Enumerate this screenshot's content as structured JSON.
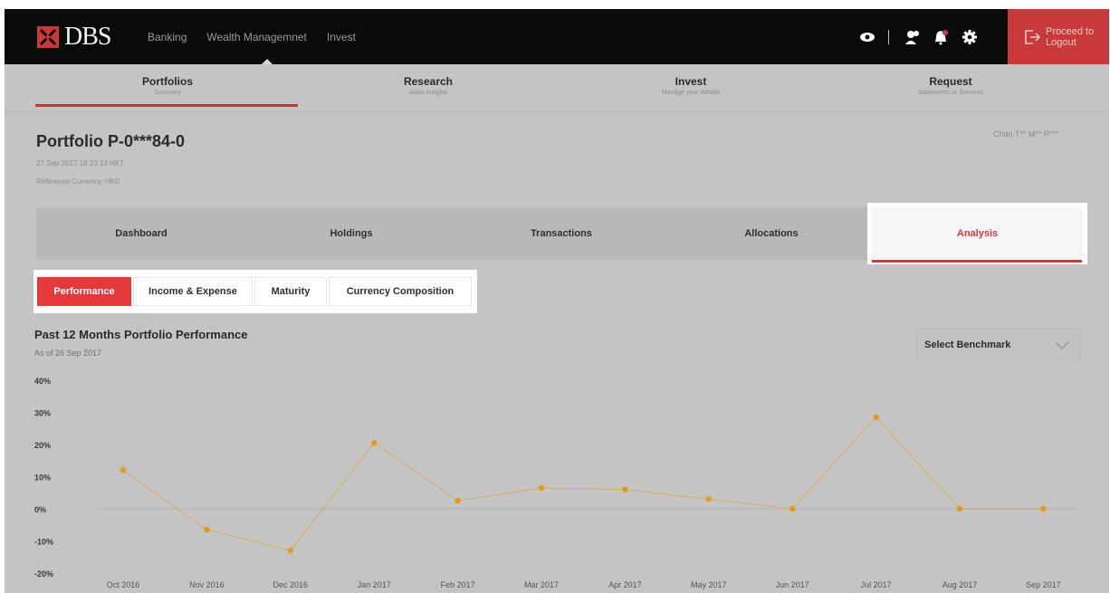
{
  "colors": {
    "brand_red": "#c9393a",
    "accent_red": "#e7383d",
    "topbar": "#0a0a0a",
    "series": "#e39a1b"
  },
  "header": {
    "logo_text": "DBS",
    "nav": [
      "Banking",
      "Wealth Managemnet",
      "Invest"
    ],
    "icons": [
      "eye-icon",
      "profile-icon",
      "notification-icon",
      "gear-icon"
    ],
    "logout_line1": "Proceed to",
    "logout_line2": "Logout"
  },
  "main_tabs": [
    {
      "label": "Portfolios",
      "sub": "Summary"
    },
    {
      "label": "Research",
      "sub": "Asian Insights"
    },
    {
      "label": "Invest",
      "sub": "Manage your Wealth"
    },
    {
      "label": "Request",
      "sub": "Statements or Services"
    }
  ],
  "portfolio": {
    "title": "Portfolio P-0***84-0",
    "timestamp": "27 Sep 2017 18:10:13 HKT",
    "currency": "Reference Currency: HKD",
    "owner": "Chan T** M** P***"
  },
  "section_tabs": [
    "Dashboard",
    "Holdings",
    "Transactions",
    "Allocations",
    "Analysis"
  ],
  "sub_tabs": [
    "Performance",
    "Income & Expense",
    "Maturity",
    "Currency Composition"
  ],
  "chart": {
    "title": "Past 12 Months Portfolio Performance",
    "subtitle": "As of 26 Sep 2017",
    "benchmark_label": "Select Benchmark"
  },
  "chart_data": {
    "type": "line",
    "title": "Past 12 Months Portfolio Performance",
    "subtitle": "As of 26 Sep 2017",
    "categories": [
      "Oct 2016",
      "Nov 2016",
      "Dec 2016",
      "Jan 2017",
      "Feb 2017",
      "Mar 2017",
      "Apr 2017",
      "May 2017",
      "Jun 2017",
      "Jul 2017",
      "Aug 2017",
      "Sep 2017"
    ],
    "values": [
      12,
      -6.5,
      -13,
      20.5,
      2.5,
      6.5,
      6,
      3,
      0,
      28.5,
      0,
      0
    ],
    "ylim": [
      -20,
      40
    ],
    "yticks": [
      "40%",
      "30%",
      "20%",
      "10%",
      "0%",
      "-10%",
      "-20%"
    ],
    "ytick_values": [
      40,
      30,
      20,
      10,
      0,
      -10,
      -20
    ],
    "grid": false,
    "zero_line": true
  }
}
